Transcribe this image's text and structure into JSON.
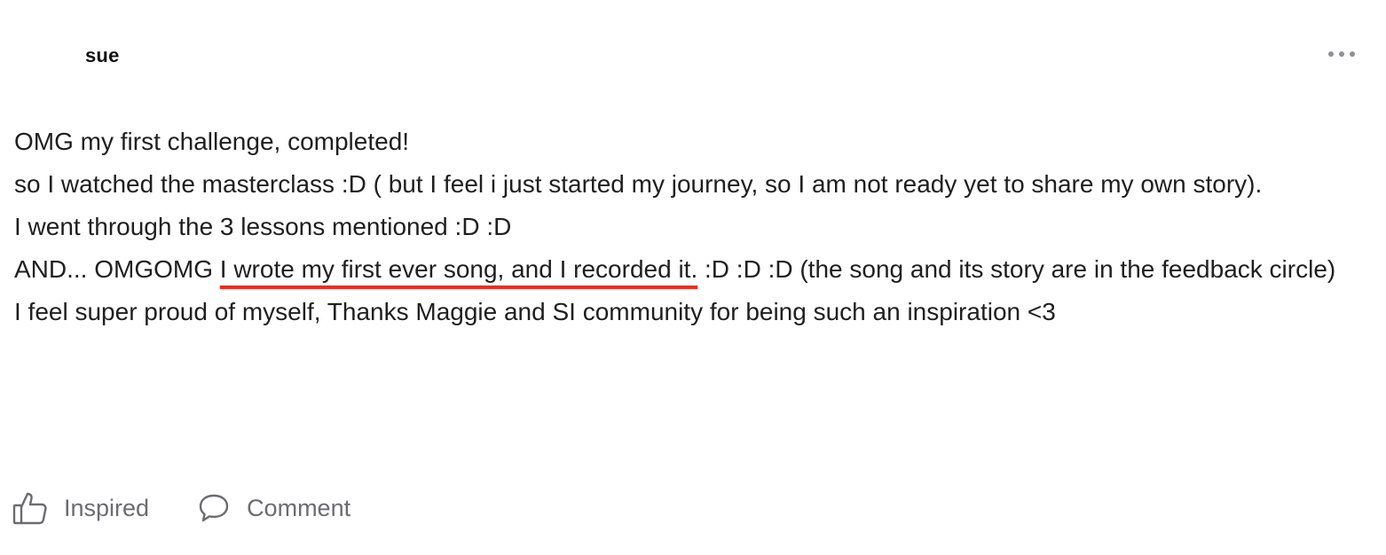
{
  "post": {
    "author": "sue",
    "paragraphs": [
      {
        "text": "OMG my first challenge, completed!"
      },
      {
        "text": "so I watched the masterclass :D ( but I feel i just started my journey, so I am not ready yet to share my own story)."
      },
      {
        "text": "I went through the 3 lessons mentioned :D :D"
      },
      {
        "before": "AND... OMGOMG ",
        "highlight": "I wrote my first ever song, and I recorded it.",
        "after": " :D :D :D (the song and its story are in the feedback circle)"
      },
      {
        "text": "I feel super proud of myself, Thanks Maggie and SI community for being such an inspiration <3"
      }
    ],
    "highlight_color": "#ee2e1e"
  },
  "actions": {
    "inspired_label": "Inspired",
    "comment_label": "Comment"
  },
  "icons": {
    "more": "more-horizontal-icon",
    "inspired": "thumbs-up-icon",
    "comment": "speech-bubble-icon"
  }
}
